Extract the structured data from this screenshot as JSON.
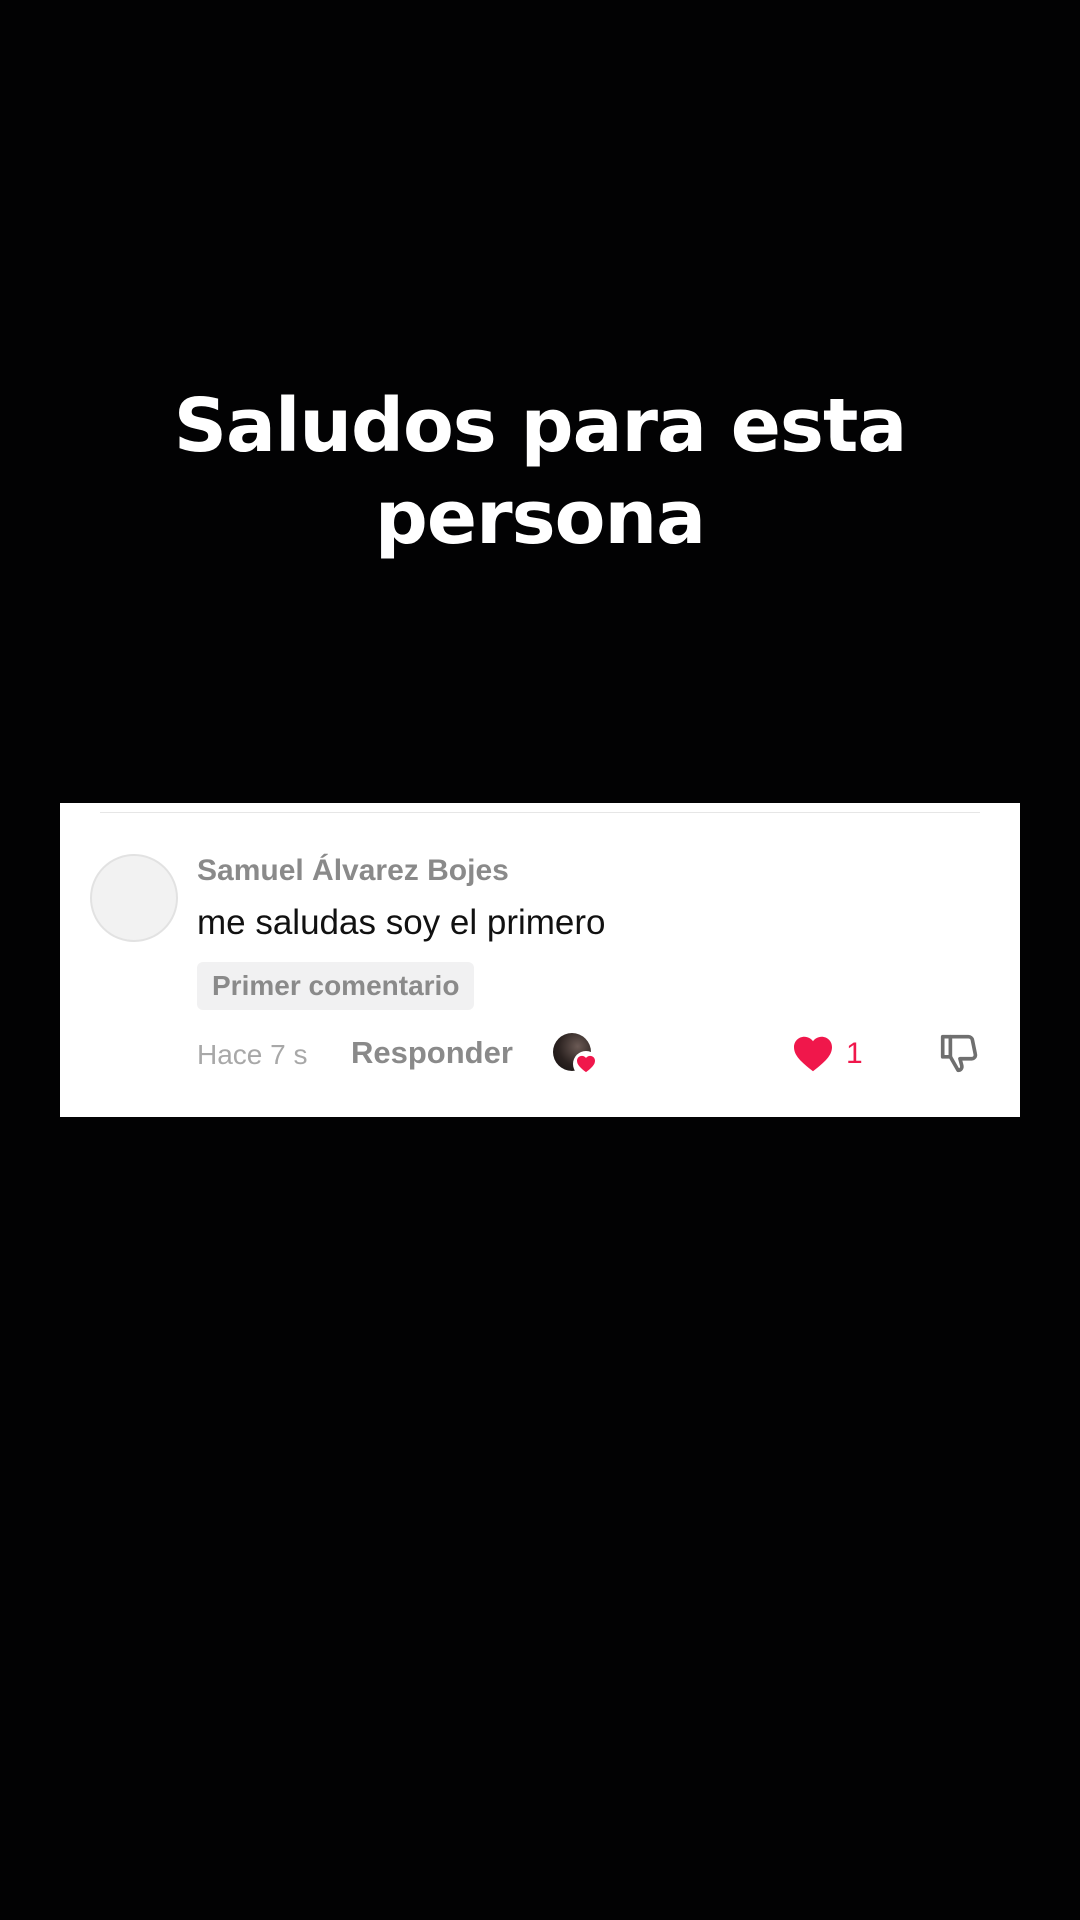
{
  "caption": {
    "line1": "Saludos para esta",
    "line2": "persona"
  },
  "comment": {
    "username": "Samuel Álvarez Bojes",
    "text": "me saludas soy el primero",
    "badge": "Primer comentario",
    "timestamp": "Hace 7 s",
    "reply_label": "Responder",
    "like_count": "1",
    "liked": true,
    "liked_by_creator": true,
    "icons": {
      "like": "heart-icon",
      "dislike": "thumbs-down-icon",
      "creator_like": "creator-heart-icon"
    },
    "colors": {
      "like_accent": "#f0174b",
      "card_background": "#ffffff",
      "page_background": "#020203"
    }
  }
}
